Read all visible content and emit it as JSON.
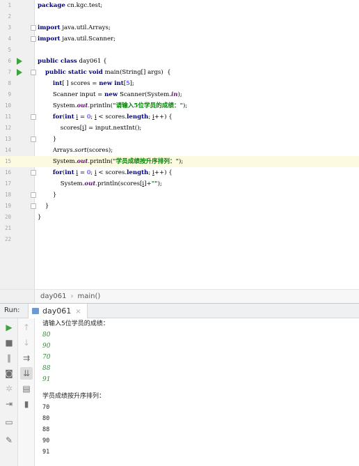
{
  "editor": {
    "lines": [
      {
        "n": "1",
        "code": "<span class=\"kw\">package</span> cn.kgc.test;"
      },
      {
        "n": "2",
        "code": ""
      },
      {
        "n": "3",
        "code": "<span class=\"kw\">import</span> java.util.Arrays;"
      },
      {
        "n": "4",
        "code": "<span class=\"kw\">import</span> java.util.Scanner;"
      },
      {
        "n": "5",
        "code": ""
      },
      {
        "n": "6",
        "code": "<span class=\"kw\">public class</span> day061 {"
      },
      {
        "n": "7",
        "code": "    <span class=\"kw\">public static void</span> main(String[] args)  {"
      },
      {
        "n": "8",
        "code": "        <span class=\"kw\">int</span>[ ] scores = <span class=\"kw\">new int</span>[<span class=\"num\">5</span>];"
      },
      {
        "n": "9",
        "code": "        Scanner input = <span class=\"kw\">new</span> Scanner(System.<span class=\"fld\">in</span>);"
      },
      {
        "n": "10",
        "code": "        System.<span class=\"fld\">out</span>.println(<span class=\"str\">\"请输入5位学员的成绩：\"</span>);"
      },
      {
        "n": "11",
        "code": "        <span class=\"kw\">for</span>(<span class=\"kw\">int</span> <span class=\"ul\">i</span> = <span class=\"num\">0</span>; <span class=\"ul\">i</span> &lt; scores.<span class=\"kw\">length</span>; <span class=\"ul\">i</span>++) {"
      },
      {
        "n": "12",
        "code": "            scores[<span class=\"ul\">i</span>] = input.nextInt();"
      },
      {
        "n": "13",
        "code": "        }"
      },
      {
        "n": "14",
        "code": "        Arrays.<span class=\"it\">sort</span>(scores);"
      },
      {
        "n": "15",
        "code": "        System.<span class=\"fld\">out</span>.println(<span class=\"str\">\"学员成绩按升序排列：\"</span>);"
      },
      {
        "n": "16",
        "code": "        <span class=\"kw\">for</span>(<span class=\"kw\">int</span> <span class=\"ul\">i</span> = <span class=\"num\">0</span>; <span class=\"ul\">i</span> &lt; scores.<span class=\"kw\">length</span>; <span class=\"ul\">i</span>++) {"
      },
      {
        "n": "17",
        "code": "            System.<span class=\"fld\">out</span>.println(scores[<span class=\"ul\">i</span>]+<span class=\"str\">\"\"</span>);"
      },
      {
        "n": "18",
        "code": "        }"
      },
      {
        "n": "19",
        "code": "    }"
      },
      {
        "n": "20",
        "code": "}"
      },
      {
        "n": "21",
        "code": ""
      },
      {
        "n": "22",
        "code": ""
      }
    ]
  },
  "breadcrumb": {
    "class": "day061",
    "method": "main()",
    "separator": "›"
  },
  "run_panel": {
    "label": "Run:",
    "tab": "day061",
    "close": "×",
    "console": [
      {
        "type": "out",
        "text": "请输入5位学员的成绩："
      },
      {
        "type": "in",
        "text": "80"
      },
      {
        "type": "in",
        "text": "90"
      },
      {
        "type": "in",
        "text": "70"
      },
      {
        "type": "in",
        "text": "88"
      },
      {
        "type": "in",
        "text": "91"
      },
      {
        "type": "out",
        "text": "学员成绩按升序排列："
      },
      {
        "type": "num",
        "text": "70"
      },
      {
        "type": "num",
        "text": "80"
      },
      {
        "type": "num",
        "text": "88"
      },
      {
        "type": "num",
        "text": "90"
      },
      {
        "type": "num",
        "text": "91"
      }
    ]
  },
  "colors": {
    "keyword": "#000080",
    "string": "#008000",
    "input": "#2f8c2f",
    "run_green": "#3fa23f",
    "highlight": "#fcfae0"
  },
  "icons": [
    "run-icon",
    "rerun-up-icon",
    "stop-icon",
    "down-icon",
    "pause-icon",
    "wrap-icon",
    "camera-icon",
    "scroll-end-icon",
    "settings-icon",
    "print-icon",
    "login-icon",
    "trash-icon",
    "layout-icon",
    "pin-icon"
  ]
}
